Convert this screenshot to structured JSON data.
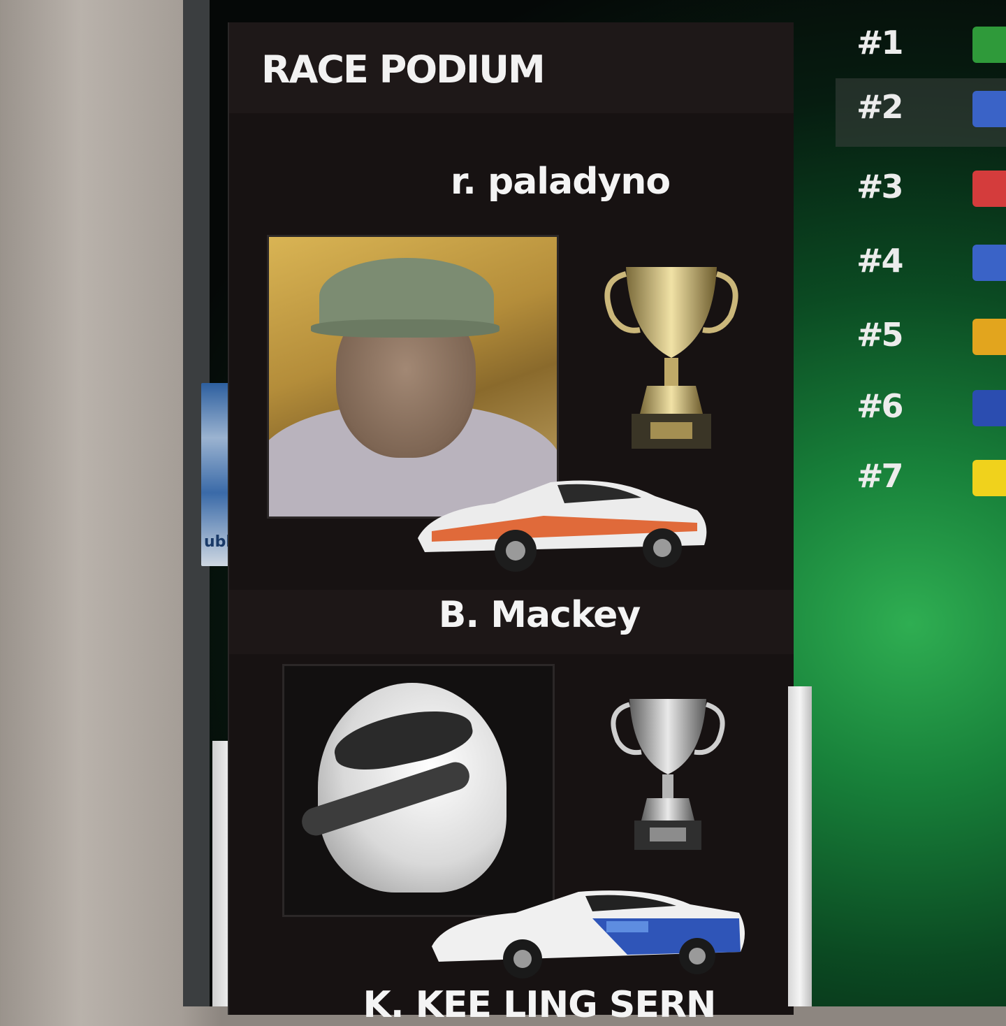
{
  "podium": {
    "title": "RACE PODIUM",
    "drivers": [
      {
        "name": "r. paladyno",
        "avatar": "profile-photo"
      },
      {
        "name": "B. Mackey",
        "avatar": "helmet-icon"
      },
      {
        "name": "K. KEE LING SERN"
      }
    ]
  },
  "side_widget": {
    "text": "ubl"
  },
  "standings": [
    {
      "position": "#1",
      "flag_color": "#2f9a3a"
    },
    {
      "position": "#2",
      "flag_color": "#3a63c7"
    },
    {
      "position": "#3",
      "flag_color": "#d43c3c"
    },
    {
      "position": "#4",
      "flag_color": "#3a63c7"
    },
    {
      "position": "#5",
      "flag_color": "#e2a51e"
    },
    {
      "position": "#6",
      "flag_color": "#2b4db0"
    },
    {
      "position": "#7",
      "flag_color": "#f0d21c"
    }
  ],
  "colors": {
    "panel": "#171212",
    "text": "#f2f2f2",
    "screen_glow": "#2fae52"
  }
}
